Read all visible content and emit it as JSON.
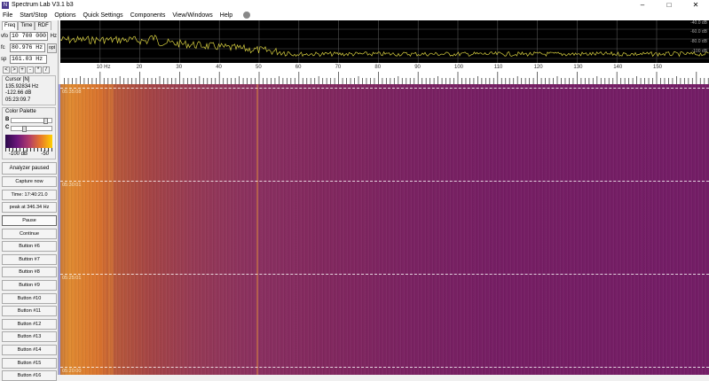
{
  "window": {
    "title": "Spectrum Lab V3.1 b3",
    "icon": "spectrum-lab-icon"
  },
  "menu": [
    "File",
    "Start/Stop",
    "Options",
    "Quick Settings",
    "Components",
    "View/Windows",
    "Help"
  ],
  "tabs": [
    "Freq",
    "Time",
    "RDF"
  ],
  "freq": {
    "vfo_label": "vfo",
    "vfo_value": "10 700 000",
    "vfo_unit": "Hz",
    "fc_label": "fc",
    "fc_value": "80.976 Hz",
    "opt_label": "opt",
    "sp_label": "sp",
    "sp_value": "161.03 Hz"
  },
  "nav_buttons": [
    "<",
    ">",
    "+",
    "-",
    "*",
    "/"
  ],
  "cursor": {
    "title": "Cursor [N]",
    "freq": "135.92834 Hz",
    "level": "-122.66 dB",
    "time": "05:23:09.7"
  },
  "palette": {
    "title": "Color Palette",
    "b_label": "B",
    "c_label": "C",
    "min_label": "-100 dB",
    "max_label": "-50",
    "b_value": 0.75,
    "c_value": 0.25
  },
  "buttons": [
    "Analyzer paused",
    "Capture now",
    "Time:  17:40:21.0",
    "peak at 346.34 Hz",
    "Pause",
    "Continue",
    "Button #6",
    "Button #7",
    "Button #8",
    "Button #9",
    "Button #10",
    "Button #11",
    "Button #12",
    "Button #13",
    "Button #14",
    "Button #15",
    "Button #16"
  ],
  "spectrum": {
    "db_labels": [
      "-40.0 dB",
      "-60.0 dB",
      "-80.0 dB",
      "-100 dB"
    ],
    "trace_color": "#d8d040"
  },
  "freq_axis": {
    "labels": [
      "10 Hz",
      "20",
      "30",
      "40",
      "50",
      "60",
      "70",
      "80",
      "90",
      "100",
      "110",
      "120",
      "130",
      "140",
      "150"
    ],
    "values": [
      10,
      20,
      30,
      40,
      50,
      60,
      70,
      80,
      90,
      100,
      110,
      120,
      130,
      140,
      150
    ],
    "max_hz": 163
  },
  "waterfall": {
    "time_labels": [
      "05:35:08",
      "05:30:01",
      "05:25:01",
      "05:20:00"
    ]
  }
}
